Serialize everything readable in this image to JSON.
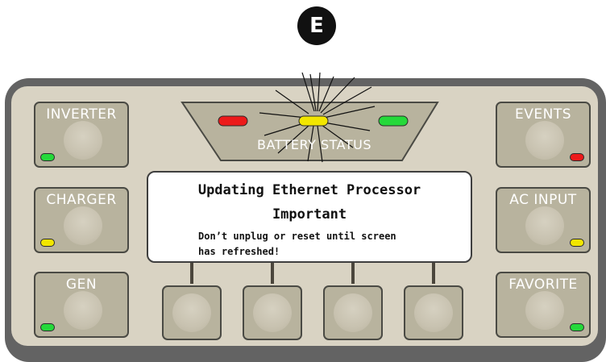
{
  "callout": {
    "letter": "E"
  },
  "left_buttons": [
    {
      "label": "INVERTER",
      "led": "green"
    },
    {
      "label": "CHARGER",
      "led": "yellow"
    },
    {
      "label": "GEN",
      "led": "green"
    }
  ],
  "right_buttons": [
    {
      "label": "EVENTS",
      "led": "red"
    },
    {
      "label": "AC INPUT",
      "led": "yellow"
    },
    {
      "label": "FAVORITE",
      "led": "green"
    }
  ],
  "battery_status": {
    "label": "BATTERY STATUS",
    "leds": [
      "red",
      "yellow",
      "green"
    ],
    "active_led": "yellow"
  },
  "screen": {
    "title": "Updating Ethernet Processor",
    "subtitle": "Important",
    "message_line1": "Don’t unplug or reset until screen",
    "message_line2": "has refreshed!"
  },
  "soft_keys_count": 4,
  "colors": {
    "panel_frame": "#636363",
    "panel_face": "#d9d3c3",
    "button_face": "#b8b39e",
    "led_green": "#25d93a",
    "led_yellow": "#f2e600",
    "led_red": "#ec1a1a"
  }
}
